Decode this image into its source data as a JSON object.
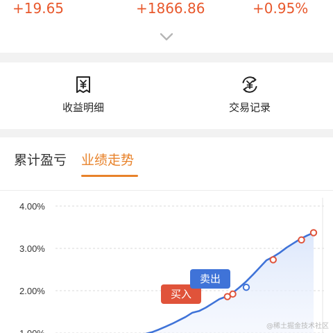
{
  "stats": {
    "values": [
      "+19.65",
      "+1866.86",
      "+0.95%"
    ],
    "color": "#e8582c"
  },
  "expand_icon": "chevron-down-icon",
  "shortcuts": [
    {
      "label": "收益明细",
      "icon": "yuan-receipt-icon"
    },
    {
      "label": "交易记录",
      "icon": "yuan-exchange-icon"
    }
  ],
  "tabs": [
    {
      "label": "累计盈亏",
      "active": false
    },
    {
      "label": "业绩走势",
      "active": true
    }
  ],
  "accent": "#e8822a",
  "chart_data": {
    "type": "area",
    "yticks": [
      "4.00%",
      "3.00%",
      "2.00%",
      "1.00%"
    ],
    "ylim": [
      0.0,
      4.0
    ],
    "series": [
      {
        "line_color": "#3f73d8",
        "points": [
          [
            0,
            0.92
          ],
          [
            1,
            0.95
          ],
          [
            2,
            0.98
          ],
          [
            3,
            1.02
          ],
          [
            4,
            1.08
          ],
          [
            5,
            1.15
          ],
          [
            6,
            1.22
          ],
          [
            7,
            1.3
          ],
          [
            8,
            1.38
          ],
          [
            9,
            1.48
          ],
          [
            10,
            1.52
          ],
          [
            11,
            1.6
          ],
          [
            12,
            1.7
          ],
          [
            13,
            1.8
          ],
          [
            14,
            1.86
          ],
          [
            15,
            1.95
          ],
          [
            16,
            2.08
          ],
          [
            17,
            2.22
          ],
          [
            18,
            2.38
          ],
          [
            19,
            2.55
          ],
          [
            20,
            2.72
          ],
          [
            21,
            2.8
          ],
          [
            22,
            2.9
          ],
          [
            23,
            3.02
          ],
          [
            24,
            3.12
          ],
          [
            25,
            3.22
          ],
          [
            26,
            3.3
          ],
          [
            27,
            3.37
          ]
        ]
      }
    ],
    "markers": [
      {
        "x": 14.2,
        "y": 1.86,
        "type": "buy"
      },
      {
        "x": 15.0,
        "y": 1.92,
        "type": "buy"
      },
      {
        "x": 17.0,
        "y": 2.08,
        "type": "sell"
      },
      {
        "x": 21.0,
        "y": 2.73,
        "type": "buy"
      },
      {
        "x": 25.2,
        "y": 3.2,
        "type": "buy"
      },
      {
        "x": 27.0,
        "y": 3.37,
        "type": "buy"
      }
    ],
    "annotations": {
      "buy": "买入",
      "sell": "卖出"
    },
    "buy_color": "#e0533a",
    "sell_color": "#3f73d8",
    "grid": true
  },
  "watermark": "@稀土掘金技术社区"
}
